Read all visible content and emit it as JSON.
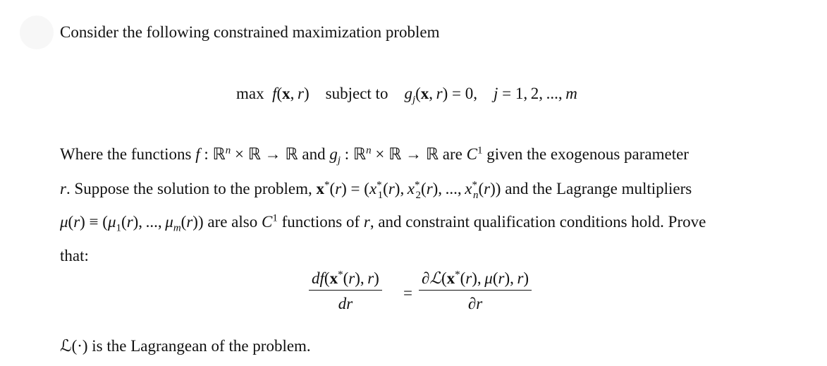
{
  "badge": {
    "icon": "avatar-circle"
  },
  "intro": "Consider the following constrained maximization problem",
  "problem": {
    "objective_prefix": "max",
    "objective": "f(x, r)",
    "subject_to": "subject to",
    "constraint": "g_j(x, r) = 0,",
    "index_range": "j = 1, 2, ..., m"
  },
  "paragraph": {
    "line1_a": "Where the functions",
    "line1_f_domain": "f : ℝⁿ × ℝ → ℝ",
    "line1_and": "and",
    "line1_g_domain": "g_j : ℝⁿ × ℝ → ℝ",
    "line1_b": "are",
    "line1_c1": "C¹",
    "line1_c": "given the exogenous parameter",
    "line2_r": "r.",
    "line2_a": "Suppose the solution to the problem,",
    "line2_sol": "x*(r) = (x₁*(r), x₂*(r), ..., xₙ*(r))",
    "line2_b": "and the Lagrange multipliers",
    "line3_mu": "μ(r) ≡ (μ₁(r), ..., μₘ(r))",
    "line3_a": "are also",
    "line3_c1": "C¹",
    "line3_b": "functions of",
    "line3_r": "r,",
    "line3_c": "and constraint qualification conditions hold. Prove",
    "line4": "that:"
  },
  "result": {
    "lhs_num": "df(x*(r), r)",
    "lhs_den": "dr",
    "equals": "=",
    "rhs_num": "∂ℒ(x*(r), μ(r), r)",
    "rhs_den": "∂r"
  },
  "footer": {
    "symbol": "ℒ(·)",
    "text": "is the Lagrangean of the problem."
  }
}
